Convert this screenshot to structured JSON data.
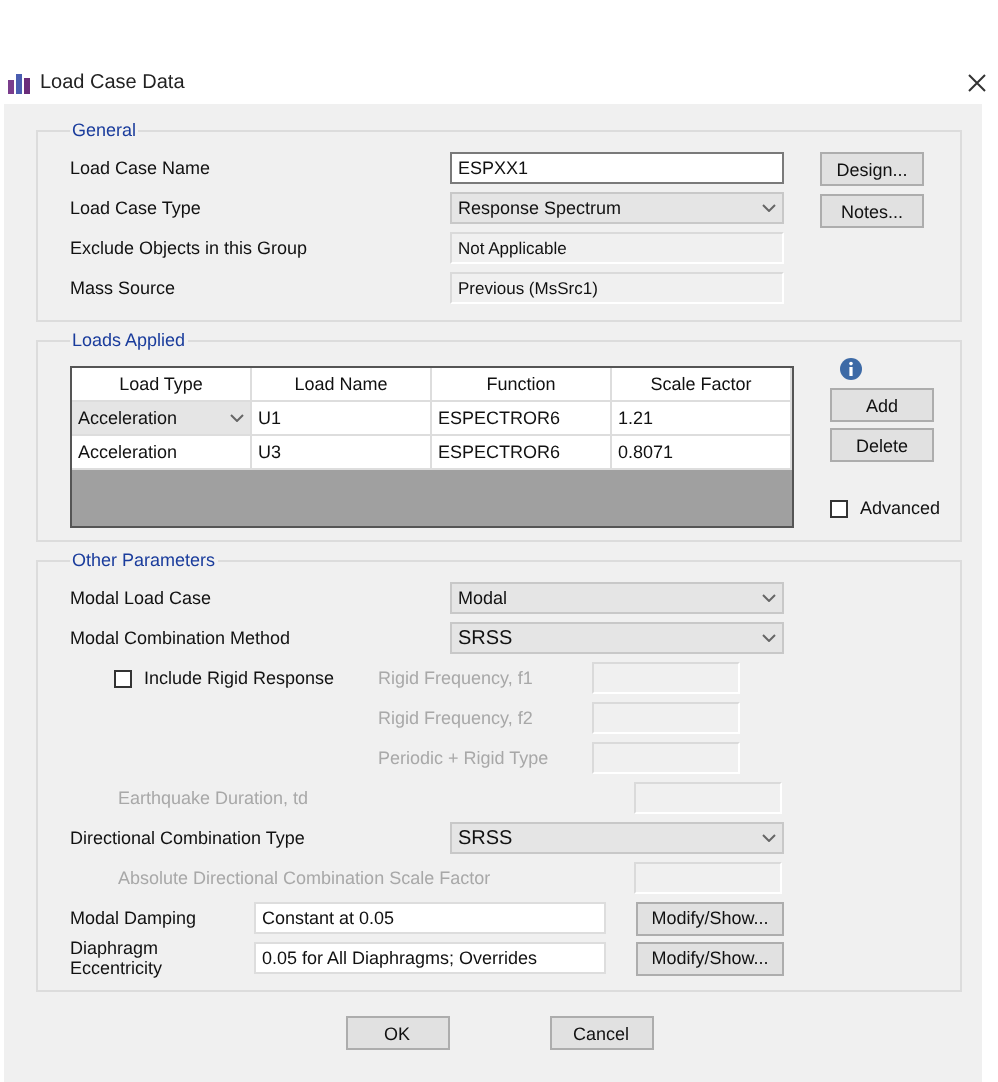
{
  "window": {
    "title": "Load Case Data"
  },
  "general": {
    "legend": "General",
    "fields": [
      {
        "label": "Load Case Name",
        "kind": "text",
        "value": "ESPXX1"
      },
      {
        "label": "Load Case Type",
        "kind": "dropdown",
        "value": "Response Spectrum"
      },
      {
        "label": "Exclude Objects in this Group",
        "kind": "readonly",
        "value": "Not Applicable"
      },
      {
        "label": "Mass Source",
        "kind": "readonly",
        "value": "Previous  (MsSrc1)"
      }
    ],
    "buttons": [
      "Design...",
      "Notes..."
    ]
  },
  "loads_applied": {
    "legend": "Loads Applied",
    "columns": [
      "Load Type",
      "Load Name",
      "Function",
      "Scale Factor"
    ],
    "rows": [
      {
        "load_type": "Acceleration",
        "editing": true,
        "load_name": "U1",
        "function": "ESPECTROR6",
        "scale_factor": "1.21"
      },
      {
        "load_type": "Acceleration",
        "editing": false,
        "load_name": "U3",
        "function": "ESPECTROR6",
        "scale_factor": "0.8071"
      }
    ],
    "buttons": [
      "Add",
      "Delete"
    ],
    "advanced": {
      "label": "Advanced",
      "checked": false
    }
  },
  "other_parameters": {
    "legend": "Other Parameters",
    "modal_load_case": {
      "label": "Modal Load Case",
      "value": "Modal"
    },
    "modal_combination_method": {
      "label": "Modal Combination Method",
      "value": "SRSS"
    },
    "include_rigid_response": {
      "label": "Include Rigid Response",
      "checked": false
    },
    "rigid_fields": [
      {
        "label": "Rigid Frequency, f1",
        "disabled": true
      },
      {
        "label": "Rigid Frequency, f2",
        "disabled": true
      },
      {
        "label": "Periodic + Rigid Type",
        "disabled": true
      }
    ],
    "earthquake_duration": {
      "label": "Earthquake Duration, td",
      "disabled": true
    },
    "directional_combination_type": {
      "label": "Directional Combination Type",
      "value": "SRSS"
    },
    "absolute_scale_factor": {
      "label": "Absolute Directional Combination Scale Factor",
      "disabled": true
    },
    "modal_damping": {
      "label": "Modal Damping",
      "value": "Constant at 0.05",
      "button": "Modify/Show..."
    },
    "diaphragm_eccentricity": {
      "label": "Diaphragm Eccentricity",
      "value": "0.05 for All Diaphragms; Overrides",
      "button": "Modify/Show..."
    }
  },
  "buttons": [
    "OK",
    "Cancel"
  ]
}
